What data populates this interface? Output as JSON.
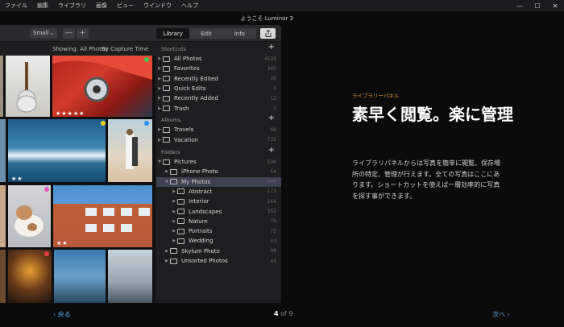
{
  "menu": [
    "ファイル",
    "編集",
    "ライブラリ",
    "画像",
    "ビュー",
    "ウインドウ",
    "ヘルプ"
  ],
  "window_title": "ようこそ Luminar 3",
  "toolbar": {
    "size": "Small",
    "zoom_out": "—",
    "zoom_in": "+",
    "tabs": [
      {
        "label": "Library",
        "active": true
      },
      {
        "label": "Edit",
        "active": false
      },
      {
        "label": "Info",
        "active": false
      }
    ]
  },
  "filter": {
    "showing": "Showing: All Photos",
    "sort": "By Capture Time"
  },
  "sidebar": {
    "shortcuts_title": "Shortcuts",
    "shortcuts": [
      {
        "label": "All Photos",
        "count": "4534",
        "icon": "photos-icon"
      },
      {
        "label": "Favorites",
        "count": "345",
        "icon": "heart-icon"
      },
      {
        "label": "Recently Edited",
        "count": "20",
        "icon": "sliders-icon"
      },
      {
        "label": "Quick Edits",
        "count": "5",
        "icon": "grid-icon"
      },
      {
        "label": "Recently Added",
        "count": "12",
        "icon": "plus-circle-icon"
      },
      {
        "label": "Trash",
        "count": "3",
        "icon": "trash-icon"
      }
    ],
    "albums_title": "Albums",
    "albums": [
      {
        "label": "Travels",
        "count": "88"
      },
      {
        "label": "Vacation",
        "count": "732"
      }
    ],
    "folders_title": "Folders",
    "folders": [
      {
        "label": "Pictures",
        "count": "536",
        "indent": 0,
        "sel": false,
        "open": true
      },
      {
        "label": "iPhone Photo",
        "count": "54",
        "indent": 1,
        "sel": false,
        "open": false
      },
      {
        "label": "My Photos",
        "count": "246",
        "indent": 1,
        "sel": true,
        "open": true
      },
      {
        "label": "Abstract",
        "count": "173",
        "indent": 2,
        "sel": false,
        "open": false
      },
      {
        "label": "Interior",
        "count": "164",
        "indent": 2,
        "sel": false,
        "open": false
      },
      {
        "label": "Landscapes",
        "count": "352",
        "indent": 2,
        "sel": false,
        "open": false
      },
      {
        "label": "Nature",
        "count": "76",
        "indent": 2,
        "sel": false,
        "open": false
      },
      {
        "label": "Portraits",
        "count": "72",
        "indent": 2,
        "sel": false,
        "open": false
      },
      {
        "label": "Wedding",
        "count": "43",
        "indent": 2,
        "sel": false,
        "open": false
      },
      {
        "label": "Skylum Photo",
        "count": "98",
        "indent": 1,
        "sel": false,
        "open": false
      },
      {
        "label": "Unsorted Photos",
        "count": "44",
        "indent": 1,
        "sel": false,
        "open": false
      }
    ]
  },
  "right": {
    "kicker": "ライブラリーパネル",
    "headline": "素早く閲覧。楽に管理",
    "description": "ライブラリパネルからは写真を簡単に閲覧、保存場所の特定、管理が行えます。全ての写真はここにあります。ショートカットを使えば一層効率的に写真を探す事ができます。"
  },
  "nav": {
    "back": "戻る",
    "page_current": "4",
    "page_total": "of 9",
    "next": "次へ"
  },
  "colors": {
    "accent_orange": "#e8922e",
    "link_blue": "#5aa6e8",
    "dot_green": "#3cc84a",
    "dot_yellow": "#f0d020",
    "dot_blue": "#2a8ef0",
    "dot_pink": "#e060c8",
    "dot_red": "#e04040"
  }
}
